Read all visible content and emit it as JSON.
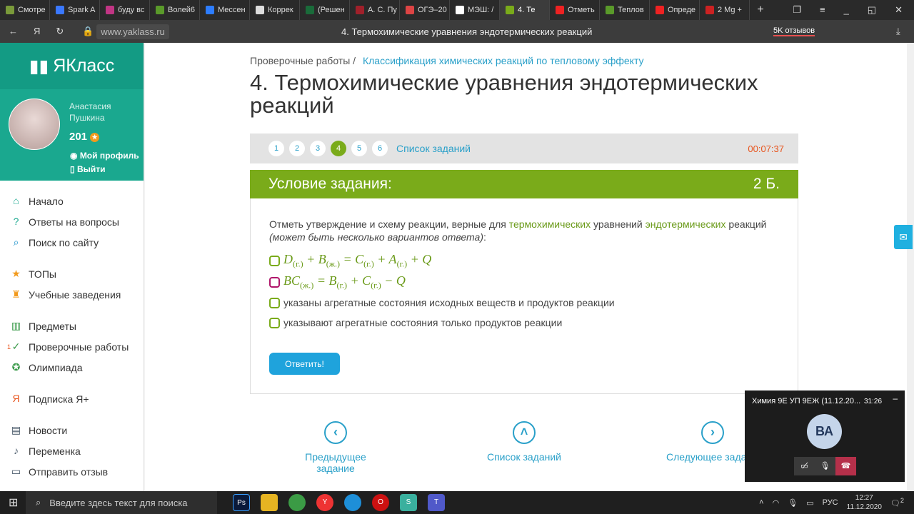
{
  "browser": {
    "tabs": [
      "Смотре",
      "Spark A",
      "буду вс",
      "Волей6",
      "Мессен",
      "Коррек",
      "(Решен",
      "А. С. Пу",
      "ОГЭ–20",
      "МЭШ: /",
      "4. Те",
      "Отметь",
      "Теплов",
      "Опреде",
      "2 Mg +"
    ],
    "active_tab": 10,
    "url": "www.yaklass.ru",
    "page_title": "4. Термохимические уравнения эндотермических реакций",
    "reviews": "5K отзывов"
  },
  "sidebar": {
    "logo": "ЯКласс",
    "user_name": "Анастасия Пушкина",
    "score": "201",
    "profile": "Мой профиль",
    "logout": "Выйти",
    "items": [
      {
        "label": "Начало",
        "icon": "home-icon"
      },
      {
        "label": "Ответы на вопросы",
        "icon": "question-icon"
      },
      {
        "label": "Поиск по сайту",
        "icon": "search-icon"
      },
      {
        "label": "ТОПы",
        "icon": "star-icon"
      },
      {
        "label": "Учебные заведения",
        "icon": "school-icon"
      },
      {
        "label": "Предметы",
        "icon": "books-icon"
      },
      {
        "label": "Проверочные работы",
        "icon": "check-icon",
        "badge": "1"
      },
      {
        "label": "Олимпиада",
        "icon": "medal-icon"
      },
      {
        "label": "Подписка Я+",
        "icon": "yaplus-icon"
      },
      {
        "label": "Новости",
        "icon": "news-icon"
      },
      {
        "label": "Переменка",
        "icon": "bell-icon"
      },
      {
        "label": "Отправить отзыв",
        "icon": "feedback-icon"
      }
    ]
  },
  "main": {
    "breadcrumb": [
      "Проверочные работы",
      "Классификация химических реакций по тепловому эффекту"
    ],
    "title": "4. Термохимические уравнения эндотермических реакций",
    "task_numbers": [
      "1",
      "2",
      "3",
      "4",
      "5",
      "6"
    ],
    "current_task": "4",
    "task_list": "Список заданий",
    "timer": "00:07:37",
    "condition_title": "Условие задания:",
    "points": "2 Б.",
    "question": {
      "p1": "Отметь утверждение и схему реакции, верные для ",
      "w1": "термохимических",
      "p2": " уравнений ",
      "w2": "эндотермических",
      "p3": " реакций",
      "hint": "(может быть несколько вариантов ответа)",
      "colon": ":"
    },
    "options": [
      "указаны агрегатные состояния исходных веществ и продуктов реакции",
      "указывают агрегатные состояния только продуктов реакции"
    ],
    "submit": "Ответить!",
    "prev": "Предыдущее задание",
    "list": "Список заданий",
    "next": "Следующее задание"
  },
  "teams": {
    "title": "Химия 9Е УП 9ЕЖ (11.12.20...",
    "time": "31:26",
    "initials": "ВА"
  },
  "taskbar": {
    "search_placeholder": "Введите здесь текст для поиска",
    "lang": "РУС",
    "time": "12:27",
    "date": "11.12.2020",
    "notifications": "2"
  }
}
